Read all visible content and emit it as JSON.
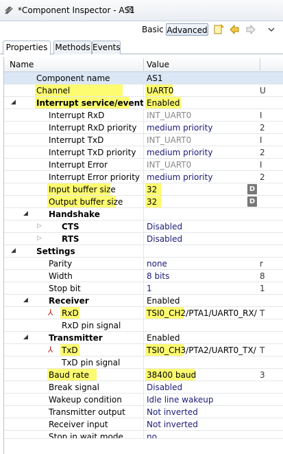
{
  "window": {
    "title": "*Component Inspector - AS1",
    "close_glyph": "⊠"
  },
  "toolbar": {
    "basic_label": "Basic",
    "advanced_label": "Advanced"
  },
  "tabs": [
    {
      "label": "Properties"
    },
    {
      "label": "Methods"
    },
    {
      "label": "Events"
    }
  ],
  "grid": {
    "header_name": "Name",
    "header_value": "Value",
    "rows": [
      {
        "name": "Component name",
        "value": "AS1",
        "extra": ""
      },
      {
        "name": "Channel",
        "value": "UART0",
        "extra": "U"
      },
      {
        "name": "Interrupt service/event",
        "value": "Enabled",
        "extra": ""
      },
      {
        "name": "Interrupt RxD",
        "value": "INT_UART0",
        "extra": "I"
      },
      {
        "name": "Interrupt RxD priority",
        "value": "medium priority",
        "extra": "2"
      },
      {
        "name": "Interrupt TxD",
        "value": "INT_UART0",
        "extra": "I"
      },
      {
        "name": "Interrupt TxD priority",
        "value": "medium priority",
        "extra": "2"
      },
      {
        "name": "Interrupt Error",
        "value": "INT_UART0",
        "extra": "I"
      },
      {
        "name": "Interrupt Error priority",
        "value": "medium priority",
        "extra": "2"
      },
      {
        "name": "Input buffer size",
        "value": "32",
        "extra": ""
      },
      {
        "name": "Output buffer size",
        "value": "32",
        "extra": ""
      },
      {
        "name": "Handshake",
        "value": "",
        "extra": ""
      },
      {
        "name": "CTS",
        "value": "Disabled",
        "extra": ""
      },
      {
        "name": "RTS",
        "value": "Disabled",
        "extra": ""
      },
      {
        "name": "Settings",
        "value": "",
        "extra": ""
      },
      {
        "name": "Parity",
        "value": "none",
        "extra": "r"
      },
      {
        "name": "Width",
        "value": "8 bits",
        "extra": "8"
      },
      {
        "name": "Stop bit",
        "value": "1",
        "extra": "1"
      },
      {
        "name": "Receiver",
        "value": "Enabled",
        "extra": ""
      },
      {
        "name": "RxD",
        "value": "TSI0_CH2/PTA1/UART0_RX/",
        "extra": "T"
      },
      {
        "name": "RxD pin signal",
        "value": "",
        "extra": ""
      },
      {
        "name": "Transmitter",
        "value": "Enabled",
        "extra": ""
      },
      {
        "name": "TxD",
        "value": "TSI0_CH3/PTA2/UART0_TX/",
        "extra": "T"
      },
      {
        "name": "TxD pin signal",
        "value": "",
        "extra": ""
      },
      {
        "name": "Baud rate",
        "value": "38400 baud",
        "extra": "3"
      },
      {
        "name": "Break signal",
        "value": "Disabled",
        "extra": ""
      },
      {
        "name": "Wakeup condition",
        "value": "Idle line wakeup",
        "extra": ""
      },
      {
        "name": "Transmitter output",
        "value": "Not inverted",
        "extra": ""
      },
      {
        "name": "Receiver input",
        "value": "Not inverted",
        "extra": ""
      },
      {
        "name": "Stop in wait mode",
        "value": "no",
        "extra": ""
      }
    ],
    "d_button_label": "D"
  },
  "colors": {
    "highlight": "#fdfb70",
    "value_text": "#1a1a7a",
    "selected_row": "#dbe7f5"
  },
  "icons": [
    "component-icon",
    "close-icon",
    "new-icon",
    "back-icon",
    "forward-icon",
    "menu-chevron-icon",
    "expand-icon",
    "collapse-icon",
    "pin-icon"
  ]
}
